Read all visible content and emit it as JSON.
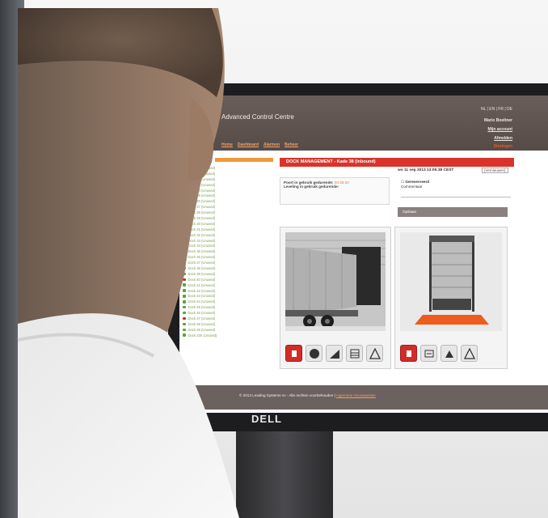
{
  "app": {
    "title": "Advanced Control Centre",
    "languages": "NL | EN | FR | DE",
    "user_name": "Mario Boeltner",
    "account_link": "Mijn account",
    "logout_link": "Afmelden",
    "header_alert": "Storingen",
    "nav": [
      "Home",
      "Dashboard",
      "Alarmen",
      "Beheer"
    ]
  },
  "sidebar": {
    "items": [
      {
        "label": "Dock 20 (Unused)",
        "color": "#b43a2c"
      },
      {
        "label": "Dock 21 (Unused)",
        "color": "#b43a2c"
      },
      {
        "label": "Dock 22 (Unused)",
        "color": "#b43a2c"
      },
      {
        "label": "Dock 23 (Unused)",
        "color": "#b43a2c"
      },
      {
        "label": "Dock 24 (Unused)",
        "color": "#b43a2c"
      },
      {
        "label": "Dock 25 (Unused)",
        "color": "#b43a2c"
      },
      {
        "label": "Dock 26 (Unused)",
        "color": "#b43a2c"
      },
      {
        "label": "Dock 27 (Unused)",
        "color": "#b43a2c"
      },
      {
        "label": "Dock 28 (Unused)",
        "color": "#b43a2c"
      },
      {
        "label": "Dock 29 (Unused)",
        "color": "#b43a2c"
      },
      {
        "label": "Dock 30 (Unused)",
        "color": "#b43a2c"
      },
      {
        "label": "Dock 31 (Unused)",
        "color": "#b43a2c"
      },
      {
        "label": "Dock 32 (Unused)",
        "color": "#b43a2c"
      },
      {
        "label": "Dock 33 (Unused)",
        "color": "#b43a2c"
      },
      {
        "label": "Dock 34 (Unused)",
        "color": "#e07a3c"
      },
      {
        "label": "Dock 35 (Unused)",
        "color": "#e07a3c"
      },
      {
        "label": "Dock 36 (Unused)",
        "color": "#5aa43c"
      },
      {
        "label": "Dock 37 (Unused)",
        "color": "#5aa43c"
      },
      {
        "label": "Dock 38 (Unused)",
        "color": "#5aa43c"
      },
      {
        "label": "Dock 39 (Unused)",
        "color": "#5aa43c"
      },
      {
        "label": "Dock 40 (Unused)",
        "color": "#b43a2c"
      },
      {
        "label": "Dock 41 (Unused)",
        "color": "#5aa43c"
      },
      {
        "label": "Dock 42 (Unused)",
        "color": "#5aa43c"
      },
      {
        "label": "Dock 43 (Unused)",
        "color": "#5aa43c"
      },
      {
        "label": "Dock 44 (Unused)",
        "color": "#5aa43c"
      },
      {
        "label": "Dock 45 (Unused)",
        "color": "#5aa43c"
      },
      {
        "label": "Dock 46 (Unused)",
        "color": "#5aa43c"
      },
      {
        "label": "Dock 47 (Unused)",
        "color": "#b43a2c"
      },
      {
        "label": "Dock 48 (Unused)",
        "color": "#5aa43c"
      },
      {
        "label": "Dock 49 (Unused)",
        "color": "#5aa43c"
      },
      {
        "label": "Dock 100 (Unused)",
        "color": "#5aa43c"
      }
    ]
  },
  "main": {
    "section_title": "DOCK MANAGEMENT - Kade 38 (Inbound)",
    "datetime": "wo 11 sep 2013 13:05:38 CEST",
    "refresh": "(Vernieuwen)",
    "info_line1_label": "Poort in gebruik gedurende:",
    "info_line1_value": "00:25:20",
    "info_line2_label": "Leveling in gebruik gedurende:",
    "reserve_label": "Gereserveerd",
    "comment_label": "Commentaar",
    "action_label": "Opslaan"
  },
  "footer": {
    "text": "© 2013 Leading Systems nv - Alle rechten voorbehouden |",
    "link": "Algemene Voorwaarden"
  },
  "monitor": {
    "brand": "DELL"
  }
}
